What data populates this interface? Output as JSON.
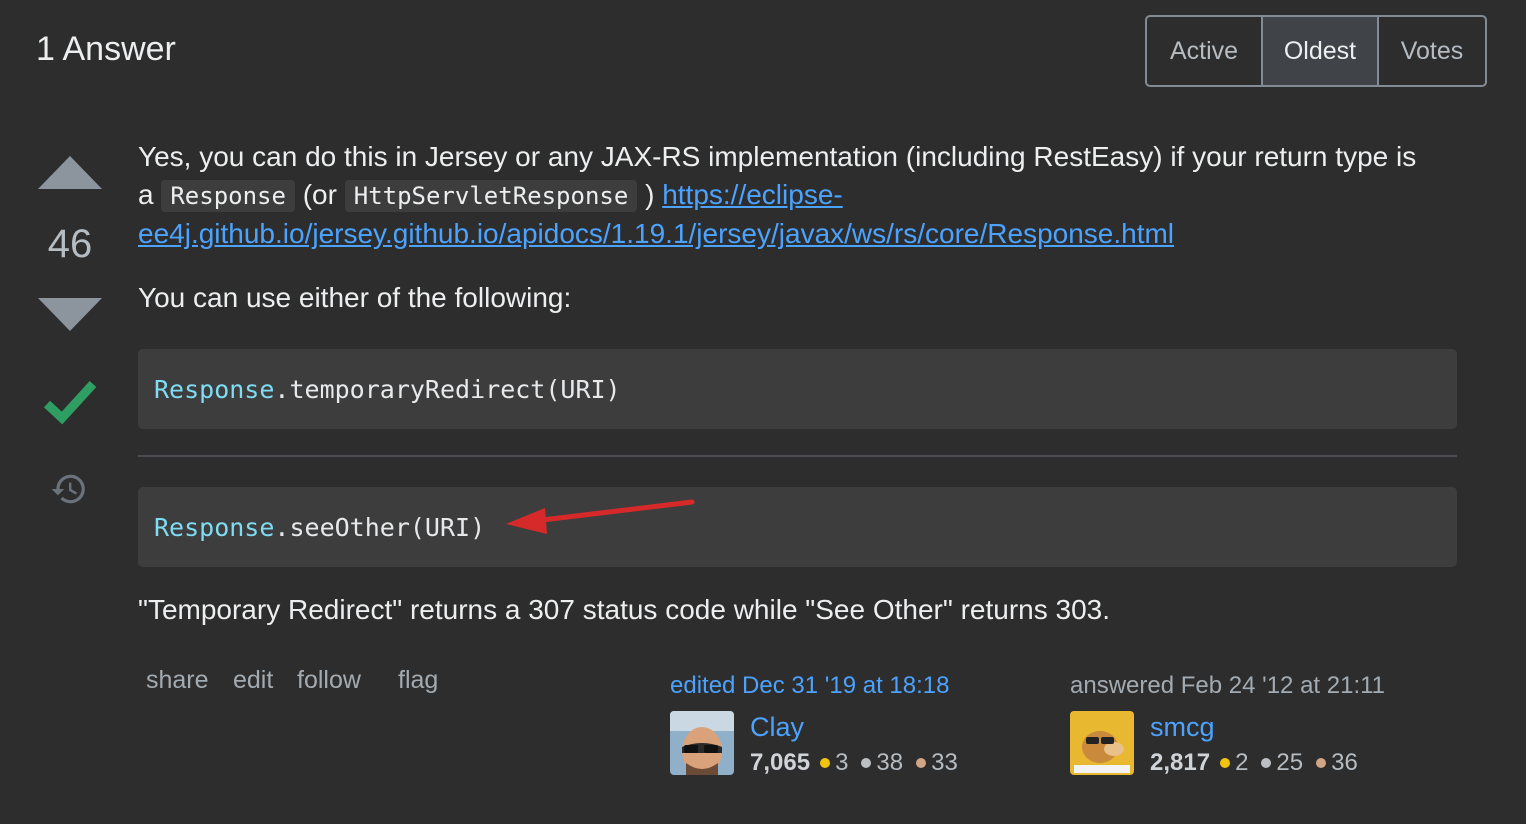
{
  "header": {
    "title": "1 Answer"
  },
  "sort": {
    "active": "Active",
    "oldest": "Oldest",
    "votes": "Votes",
    "selected": "Oldest"
  },
  "vote": {
    "count": "46",
    "accepted": true
  },
  "body": {
    "p1_a": "Yes, you can do this in Jersey or any JAX-RS implementation (including RestEasy) if your return type is a",
    "code1": "Response",
    "p1_b": "(or",
    "code2": "HttpServletResponse",
    "p1_c": ")",
    "link": "https://eclipse-ee4j.github.io/jersey.github.io/apidocs/1.19.1/jersey/javax/ws/rs/core/Response.html",
    "p2": "You can use either of the following:",
    "codeblock1": {
      "class": "Response",
      "rest": ".temporaryRedirect(URI)"
    },
    "codeblock2": {
      "class": "Response",
      "rest": ".seeOther(URI)"
    },
    "p3": "\"Temporary Redirect\" returns a 307 status code while \"See Other\" returns 303."
  },
  "menu": {
    "share": "share",
    "edit": "edit",
    "follow": "follow",
    "flag": "flag"
  },
  "editor": {
    "label": "edited Dec 31 '19 at 18:18",
    "name": "Clay",
    "reputation": "7,065",
    "gold": "3",
    "silver": "38",
    "bronze": "33"
  },
  "author": {
    "label": "answered Feb 24 '12 at 21:11",
    "name": "smcg",
    "reputation": "2,817",
    "gold": "2",
    "silver": "25",
    "bronze": "36"
  },
  "colors": {
    "link": "#4ba3ff",
    "accepted": "#2f9e62",
    "annotation_arrow": "#d62a2a"
  }
}
